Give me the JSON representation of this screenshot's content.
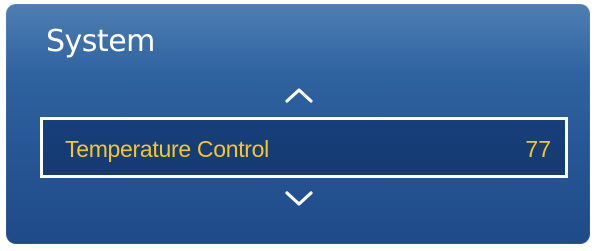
{
  "menu": {
    "title": "System",
    "selected_item": {
      "label": "Temperature Control",
      "value": "77"
    },
    "icons": {
      "up": "chevron-up-icon",
      "down": "chevron-down-icon"
    },
    "colors": {
      "panel_top": "#3a6fa8",
      "panel_bottom": "#1f4a88",
      "highlight_bg": "#173f7a",
      "highlight_border": "#ffffff",
      "selected_text": "#f2c531",
      "title_text": "#ffffff"
    }
  }
}
